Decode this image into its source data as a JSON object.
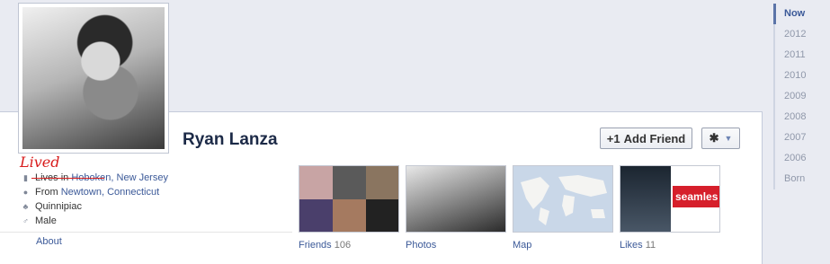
{
  "profile": {
    "name": "Ryan Lanza",
    "add_friend_label": "Add Friend",
    "annotation": "Lived"
  },
  "info": {
    "lives_text": "Lives in Hoboken, New Jersey",
    "lives_prefix": "Lives in ",
    "lives_place": "Hoboken, New Jersey",
    "from_prefix": "From ",
    "from_place": "Newtown, Connecticut",
    "school": "Quinnipiac",
    "gender": "Male",
    "about_link": "About"
  },
  "tiles": {
    "friends_label": "Friends",
    "friends_count": "106",
    "photos_label": "Photos",
    "map_label": "Map",
    "likes_label": "Likes",
    "likes_count": "11",
    "likes_banner": "seamles"
  },
  "timeline": [
    "Now",
    "2012",
    "2011",
    "2010",
    "2009",
    "2008",
    "2007",
    "2006",
    "Born"
  ],
  "icons": [
    "home-icon",
    "pin-icon",
    "graduation-icon",
    "gender-icon",
    "add-friend-icon",
    "gear-icon",
    "chevron-down-icon"
  ],
  "colors": {
    "link": "#3b5998",
    "name": "#1c2a47",
    "annotation": "#d81c1c"
  }
}
